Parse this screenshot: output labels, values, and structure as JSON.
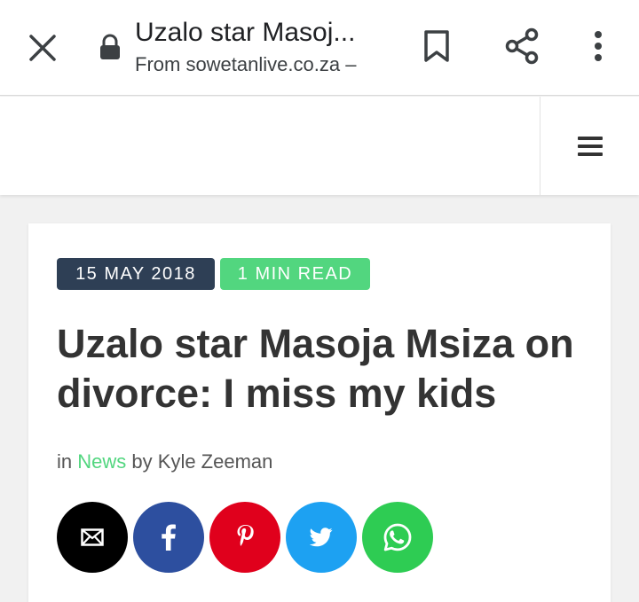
{
  "browser": {
    "page_title": "Uzalo star Masoj...",
    "page_source": "From sowetanlive.co.za –",
    "icons": [
      "close-icon",
      "lock-icon",
      "bookmark-icon",
      "share-icon",
      "more-vert-icon"
    ]
  },
  "site_header": {
    "menu_icon": "hamburger-menu-icon"
  },
  "article": {
    "date": "15 MAY 2018",
    "read_time": "1 MIN READ",
    "headline": "Uzalo star Masoja Msiza on divorce: I miss my kids",
    "byline": {
      "prefix": "in",
      "category": "News",
      "by": "by",
      "author": "Kyle Zeeman"
    },
    "share_buttons": [
      {
        "name": "email",
        "icon": "email-icon",
        "color": "#000000"
      },
      {
        "name": "facebook",
        "icon": "facebook-icon",
        "color": "#2d4f9f"
      },
      {
        "name": "pinterest",
        "icon": "pinterest-icon",
        "color": "#e0001c"
      },
      {
        "name": "twitter",
        "icon": "twitter-icon",
        "color": "#1da1f2"
      },
      {
        "name": "whatsapp",
        "icon": "whatsapp-icon",
        "color": "#2ecc53"
      }
    ]
  },
  "colors": {
    "date_badge": "#2e3f55",
    "read_badge": "#52d67f",
    "category_link": "#52d67f",
    "headline": "#333333"
  }
}
